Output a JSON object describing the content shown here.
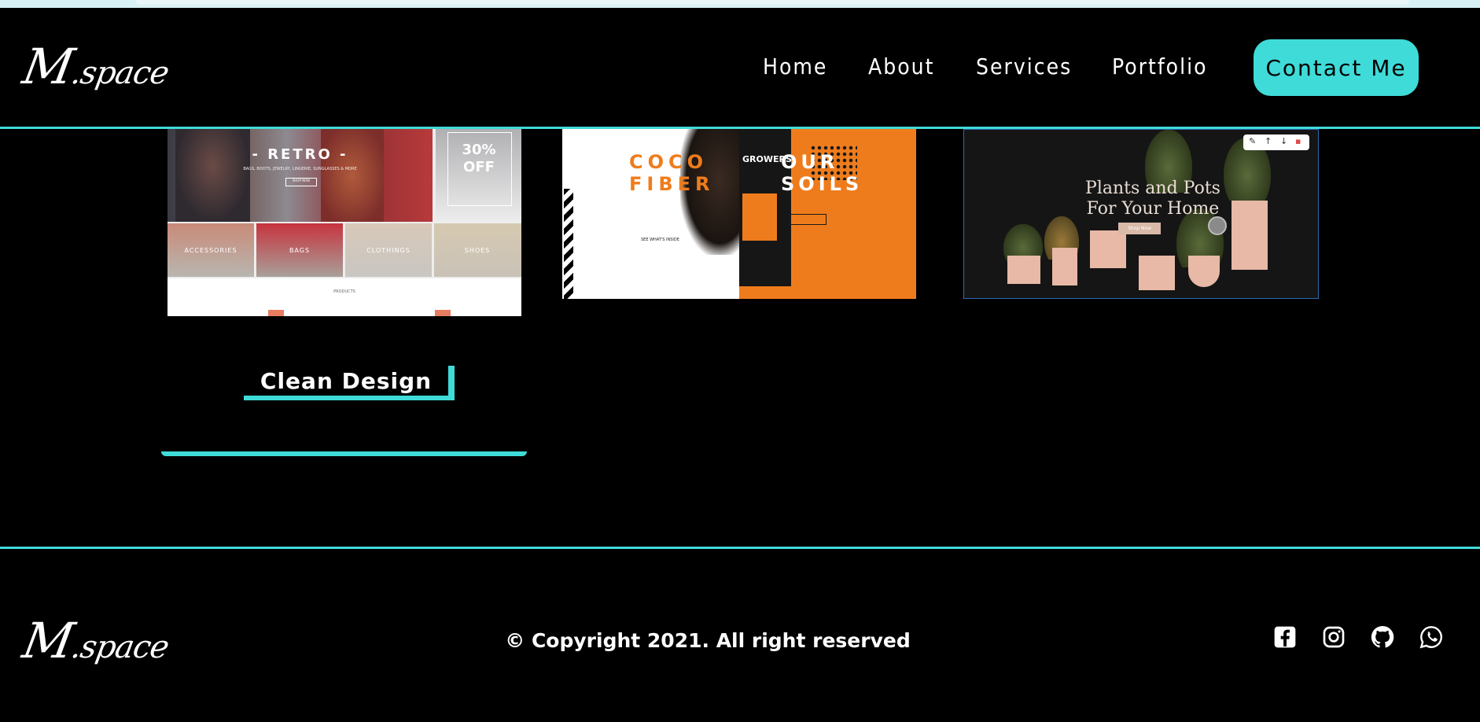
{
  "brand": {
    "logo_main": "M",
    "logo_rest": ".space"
  },
  "nav": {
    "links": [
      "Home",
      "About",
      "Services",
      "Portfolio"
    ],
    "contact_label": "Contact Me"
  },
  "portfolio": {
    "thumb1": {
      "hero_title": "- RETRO -",
      "hero_subtitle": "BAGS, BOOTS, JEWELRY, LINGERIE, SUNGLASSES & MORE",
      "hero_button": "SHOP NOW",
      "sale_text": "30% OFF",
      "tiles": [
        "ACCESSORIES",
        "BAGS",
        "CLOTHINGS",
        "SHOES"
      ],
      "products_label": "PRODUCTS"
    },
    "thumb2": {
      "coco": "COCO",
      "fiber": "FIBER",
      "our": "OUR",
      "soils": "SOILS",
      "brand": "GROWERS",
      "caption": "SEE WHAT'S INSIDE"
    },
    "thumb3": {
      "title_line1": "Plants and Pots",
      "title_line2": "For Your Home",
      "button": "Shop Now"
    },
    "tag_label": "Clean Design"
  },
  "footer": {
    "copyright": "© Copyright 2021. All right reserved",
    "social_icons": [
      "facebook-icon",
      "instagram-icon",
      "github-icon",
      "whatsapp-icon"
    ]
  },
  "colors": {
    "accent": "#3fdbd8",
    "background": "#000000",
    "text": "#ffffff",
    "orange": "#ef7c1c"
  }
}
